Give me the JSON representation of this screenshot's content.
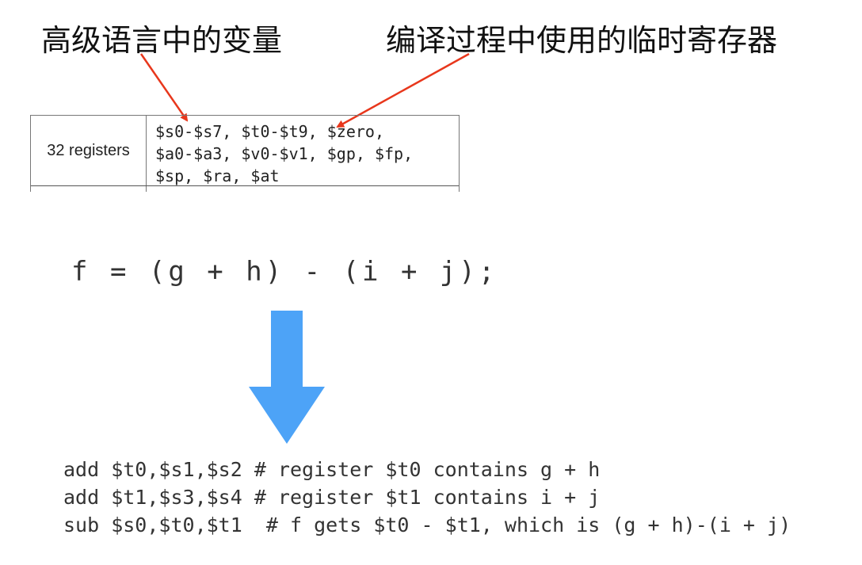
{
  "labels": {
    "high_level_var": "高级语言中的变量",
    "temp_regs": "编译过程中使用的临时寄存器"
  },
  "table": {
    "row_label": "32 registers",
    "registers": [
      "$s0-$s7, $t0-$t9, $zero,",
      "$a0-$a3, $v0-$v1, $gp, $fp,",
      "$sp, $ra, $at"
    ]
  },
  "expression": "f = (g + h) - (i + j);",
  "assembly": [
    "add $t0,$s1,$s2 # register $t0 contains g + h",
    "add $t1,$s3,$s4 # register $t1 contains i + j",
    "sub $s0,$t0,$t1  # f gets $t0 - $t1, which is (g + h)-(i + j)"
  ],
  "colors": {
    "annotation_arrow": "#e8371c",
    "flow_arrow": "#4da3f7"
  }
}
